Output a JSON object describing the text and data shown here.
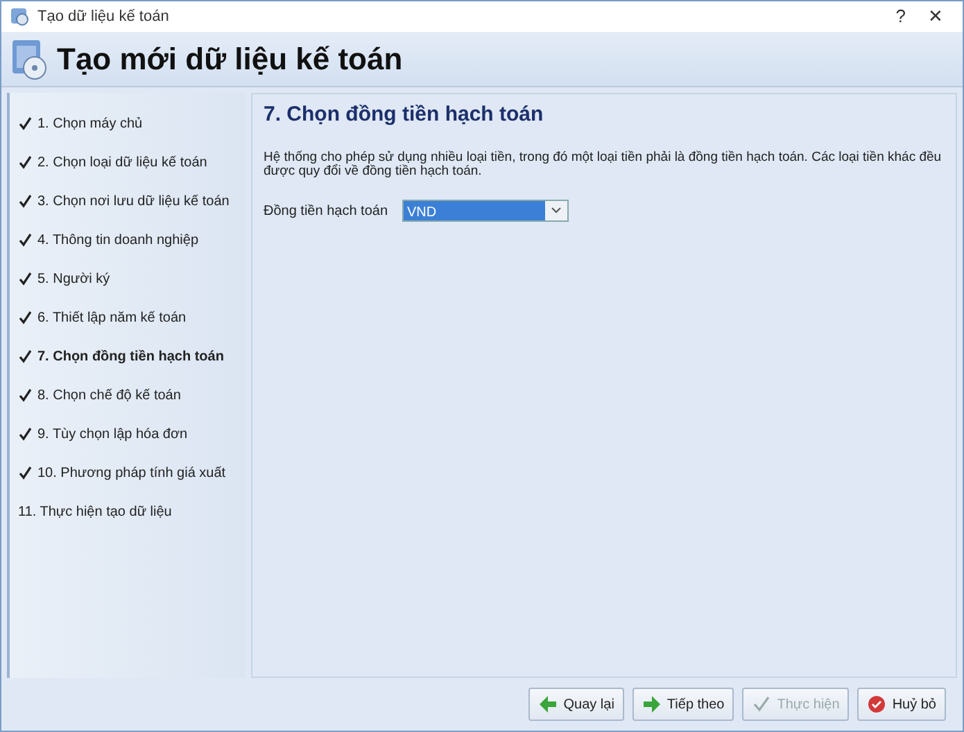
{
  "window": {
    "title": "Tạo dữ liệu kế toán",
    "controls": [
      "?",
      "✕"
    ]
  },
  "header": {
    "title": "Tạo mới dữ liệu kế toán"
  },
  "steps": [
    {
      "label": "1. Chọn máy chủ",
      "done": true,
      "selected": false
    },
    {
      "label": "2. Chọn loại dữ liệu kế toán",
      "done": true,
      "selected": false
    },
    {
      "label": "3. Chọn nơi lưu dữ liệu kế toán",
      "done": true,
      "selected": false
    },
    {
      "label": "4. Thông tin doanh nghiệp",
      "done": true,
      "selected": false
    },
    {
      "label": "5. Người ký",
      "done": true,
      "selected": false
    },
    {
      "label": "6. Thiết lập năm kế toán",
      "done": true,
      "selected": false
    },
    {
      "label": "7. Chọn đồng tiền hạch toán",
      "done": true,
      "selected": true
    },
    {
      "label": "8. Chọn chế độ kế toán",
      "done": true,
      "selected": false
    },
    {
      "label": "9. Tùy chọn lập hóa đơn",
      "done": true,
      "selected": false
    },
    {
      "label": "10. Phương pháp tính giá xuất",
      "done": true,
      "selected": false
    },
    {
      "label": "11. Thực hiện tạo dữ liệu",
      "done": false,
      "selected": false
    }
  ],
  "content": {
    "title": "7. Chọn đồng tiền hạch toán",
    "description": "Hệ thống cho phép sử dụng nhiều loại tiền, trong đó một loại tiền phải là đồng tiền hạch toán. Các loại tiền khác đều được quy đổi về đồng tiền hạch toán.",
    "field": {
      "label": "Đồng tiền hạch toán",
      "value": "VND"
    }
  },
  "buttons": [
    {
      "label": "Quay lại",
      "kind": "back",
      "disabled": false
    },
    {
      "label": "Tiếp theo",
      "kind": "next",
      "disabled": false
    },
    {
      "label": "Thực hiện",
      "kind": "finish",
      "disabled": true
    },
    {
      "label": "Huỷ bỏ",
      "kind": "cancel",
      "disabled": false
    }
  ]
}
